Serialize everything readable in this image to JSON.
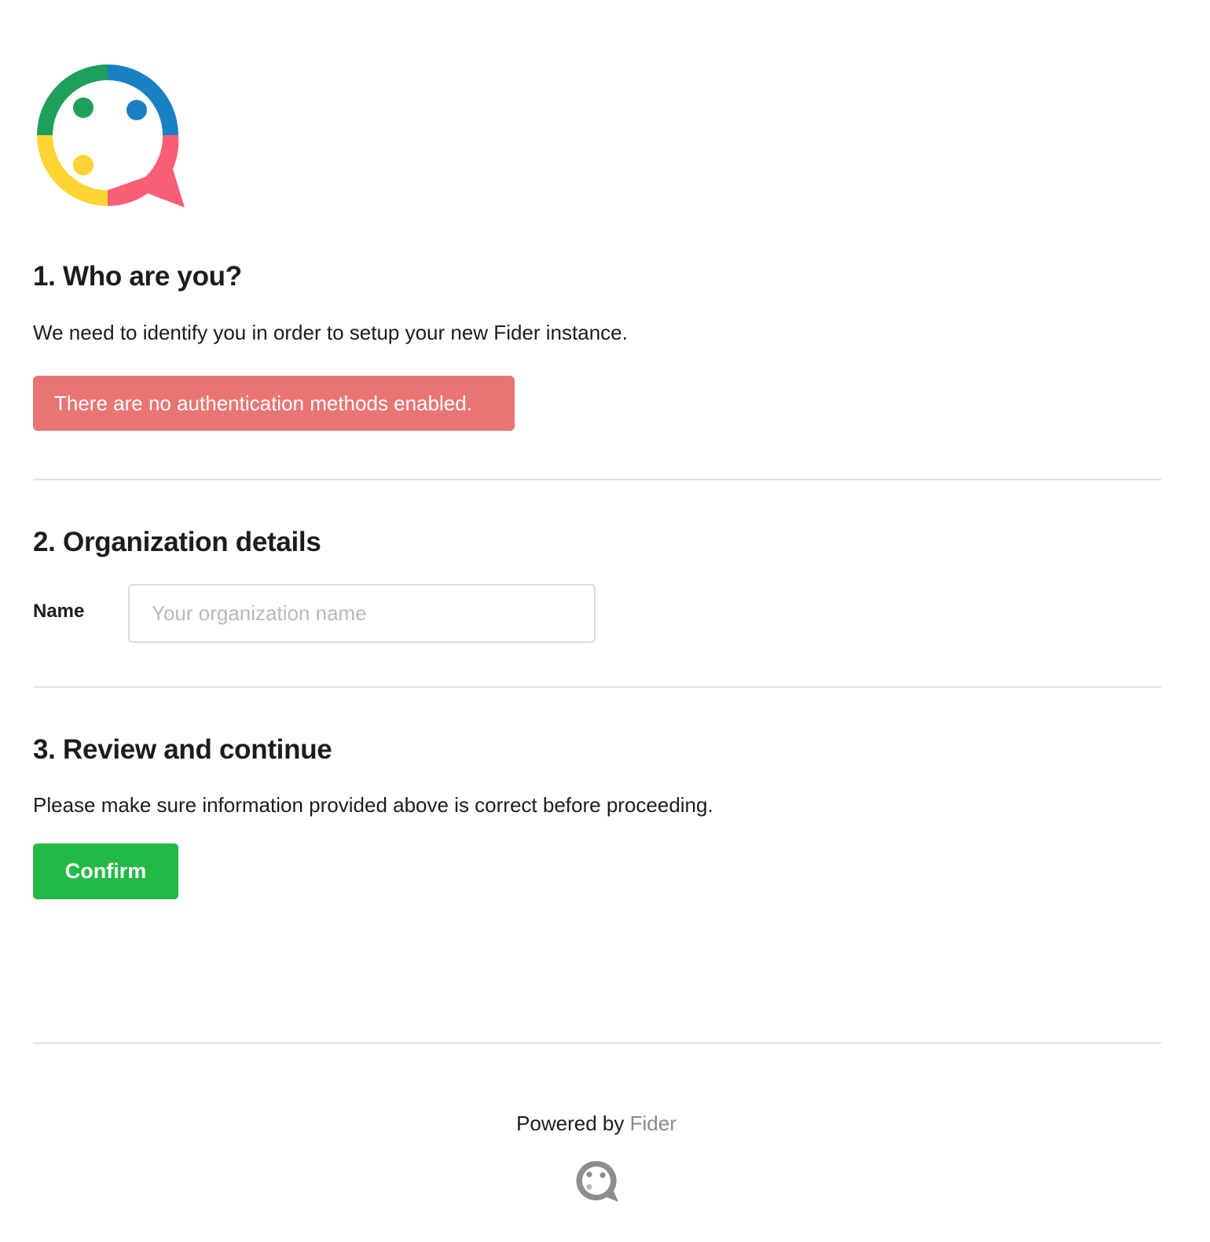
{
  "logo": {
    "icon": "fider-logo-icon",
    "colors": {
      "green": "#1ea05a",
      "blue": "#1a80c4",
      "yellow": "#fdd432",
      "red": "#f95e76"
    }
  },
  "step1": {
    "title": "1. Who are you?",
    "description": "We need to identify you in order to setup your new Fider instance.",
    "error_message": "There are no authentication methods enabled."
  },
  "step2": {
    "title": "2. Organization details",
    "name_label": "Name",
    "name_placeholder": "Your organization name",
    "name_value": ""
  },
  "step3": {
    "title": "3. Review and continue",
    "description": "Please make sure information provided above is correct before proceeding.",
    "confirm_label": "Confirm"
  },
  "footer": {
    "powered_by": "Powered by",
    "brand": "Fider",
    "icon": "fider-footer-logo-icon"
  },
  "colors": {
    "error_background": "#e97573",
    "confirm_background": "#21ba45",
    "divider": "#e2e2e3"
  }
}
